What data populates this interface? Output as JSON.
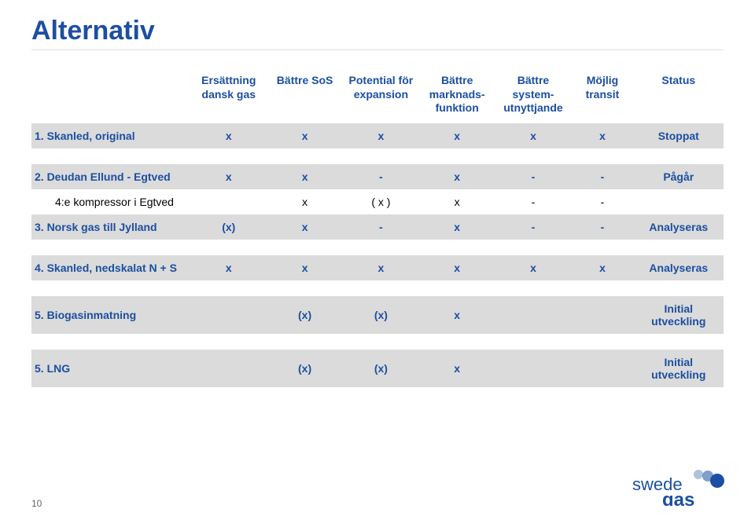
{
  "page": {
    "title": "Alternativ",
    "number": "10"
  },
  "headers": [
    "",
    "Ersättning dansk gas",
    "Bättre SoS",
    "Potential för expansion",
    "Bättre marknads-funktion",
    "Bättre system-utnyttjande",
    "Möjlig transit",
    "Status"
  ],
  "rows": [
    {
      "type": "main",
      "band": true,
      "label": "1. Skanled, original",
      "cells": [
        "x",
        "x",
        "x",
        "x",
        "x",
        "x"
      ],
      "status": "Stoppat"
    },
    {
      "type": "spacer"
    },
    {
      "type": "main",
      "band": true,
      "label": "2. Deudan Ellund - Egtved",
      "cells": [
        "x",
        "x",
        "-",
        "x",
        "-",
        "-"
      ],
      "status": "Pågår"
    },
    {
      "type": "sub",
      "band": false,
      "label": "4:e kompressor i Egtved",
      "cells": [
        "",
        "x",
        "( x )",
        "x",
        "-",
        "-"
      ],
      "status": ""
    },
    {
      "type": "main",
      "band": true,
      "label": "3. Norsk gas till Jylland",
      "cells": [
        "(x)",
        "x",
        "-",
        "x",
        "-",
        "-"
      ],
      "status": "Analyseras"
    },
    {
      "type": "spacer"
    },
    {
      "type": "main",
      "band": true,
      "label": "4. Skanled, nedskalat N + S",
      "cells": [
        "x",
        "x",
        "x",
        "x",
        "x",
        "x"
      ],
      "status": "Analyseras"
    },
    {
      "type": "spacer"
    },
    {
      "type": "main",
      "band": true,
      "label": "5. Biogasinmatning",
      "cells": [
        "",
        "(x)",
        "(x)",
        "x",
        "",
        ""
      ],
      "status": "Initial utveckling"
    },
    {
      "type": "spacer"
    },
    {
      "type": "main",
      "band": true,
      "label": "5. LNG",
      "cells": [
        "",
        "(x)",
        "(x)",
        "x",
        "",
        ""
      ],
      "status": "Initial utveckling"
    }
  ],
  "logo": {
    "text1": "swede",
    "text2": "gas"
  }
}
